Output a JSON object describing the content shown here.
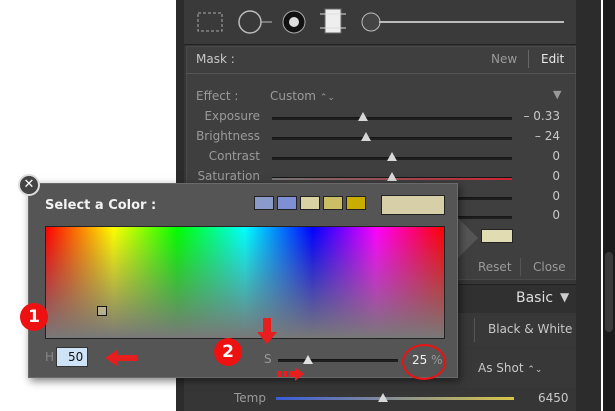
{
  "toolbar": {
    "icons": [
      "marquee-icon",
      "spot-removal-icon",
      "red-eye-icon",
      "graduated-filter-icon",
      "brush-slider-icon"
    ]
  },
  "mask": {
    "label": "Mask :",
    "new_label": "New",
    "edit_label": "Edit",
    "effect_label": "Effect :",
    "effect_value": "Custom",
    "effect_chevron": "⌃⌄",
    "collapse_glyph": "▼",
    "sliders": [
      {
        "label": "Exposure",
        "value": "– 0.33",
        "position": 0.38
      },
      {
        "label": "Brightness",
        "value": "– 24",
        "position": 0.39
      },
      {
        "label": "Contrast",
        "value": "0",
        "position": 0.5
      },
      {
        "label": "Saturation",
        "value": "0",
        "position": 0.5
      },
      {
        "label": "",
        "value": "0",
        "position": 0.5
      },
      {
        "label": "",
        "value": "0",
        "position": 0.5
      }
    ],
    "reset_label": "Reset",
    "close_label": "Close",
    "swatch_color": "#e2dcb3"
  },
  "basic": {
    "title": "Basic",
    "bw_label": "Black & White",
    "wb_value": "As Shot",
    "temp_label": "Temp",
    "temp_value": "6450",
    "temp_position": 0.45
  },
  "dialog": {
    "title": "Select a Color :",
    "close_glyph": "✕",
    "swatches": [
      "#8a9acb",
      "#7f8fd6",
      "#d9d2a2",
      "#cbbe64",
      "#c9ad00"
    ],
    "current_color": "#d6cfa8",
    "h_label": "H",
    "h_value": "50",
    "s_label": "S",
    "s_value": "25",
    "s_unit": "%",
    "s_position": 0.25
  },
  "annotations": {
    "badge1": "1",
    "badge2": "2",
    "accent": "#e61e1e"
  }
}
